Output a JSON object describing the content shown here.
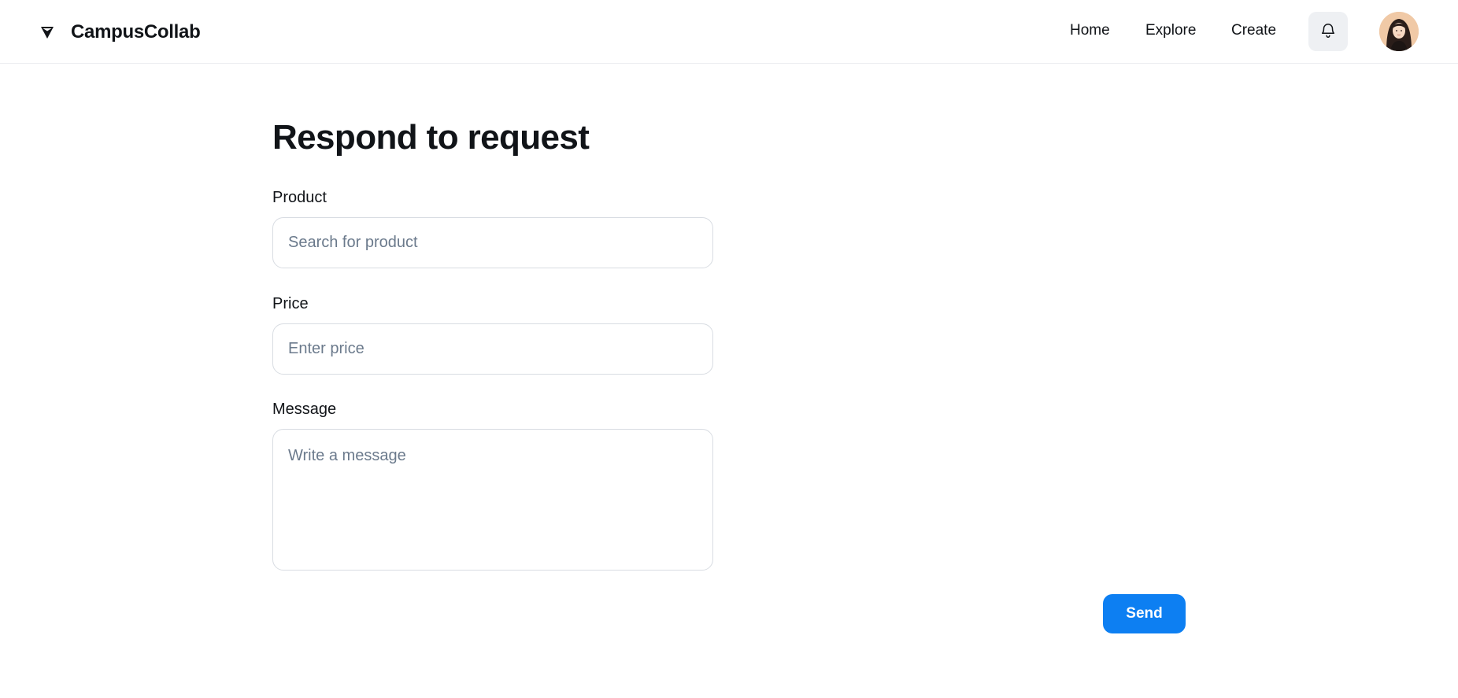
{
  "header": {
    "brand_name": "CampusCollab",
    "brand_icon": "triangle-logo-icon",
    "nav": {
      "home": "Home",
      "explore": "Explore",
      "create": "Create"
    },
    "notifications_icon": "bell-icon",
    "avatar_icon": "user-avatar"
  },
  "main": {
    "title": "Respond to request",
    "product": {
      "label": "Product",
      "placeholder": "Search for product",
      "value": ""
    },
    "price": {
      "label": "Price",
      "placeholder": "Enter price",
      "value": ""
    },
    "message": {
      "label": "Message",
      "placeholder": "Write a message",
      "value": ""
    },
    "send_label": "Send"
  },
  "colors": {
    "accent": "#0d7ff2",
    "text": "#111418",
    "placeholder": "#6b7a8c",
    "border": "#d8dce2",
    "icon_button_bg": "#eef0f3"
  }
}
